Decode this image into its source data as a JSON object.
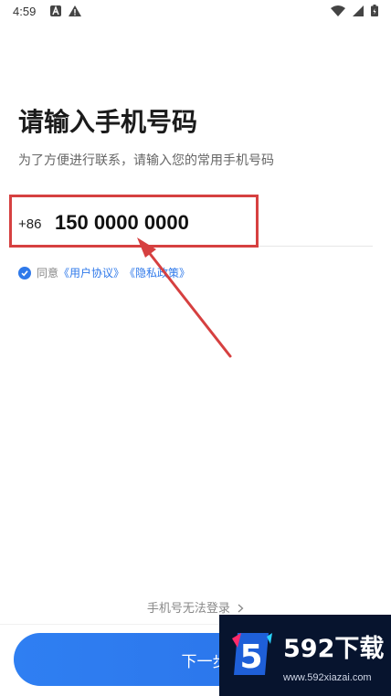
{
  "status_bar": {
    "time": "4:59",
    "left_icons": [
      "a-notification-icon",
      "warning-icon"
    ],
    "right_icons": [
      "wifi-icon",
      "signal-icon",
      "battery-icon"
    ]
  },
  "main": {
    "title": "请输入手机号码",
    "subtitle": "为了方便进行联系，请输入您的常用手机号码",
    "country_code": "+86",
    "phone_value": "150 0000 0000",
    "agreement": {
      "checked": true,
      "prefix": "同意",
      "user_agreement": "《用户协议》",
      "privacy_policy": "《隐私政策》"
    }
  },
  "footer": {
    "cannot_login": "手机号无法登录",
    "next_button": "下一步"
  },
  "watermark": {
    "badge": "5",
    "title": "592下载",
    "url": "www.592xiazai.com"
  },
  "colors": {
    "accent": "#2f79ea",
    "annotation_red": "#d64040",
    "watermark_bg": "#07142e"
  }
}
